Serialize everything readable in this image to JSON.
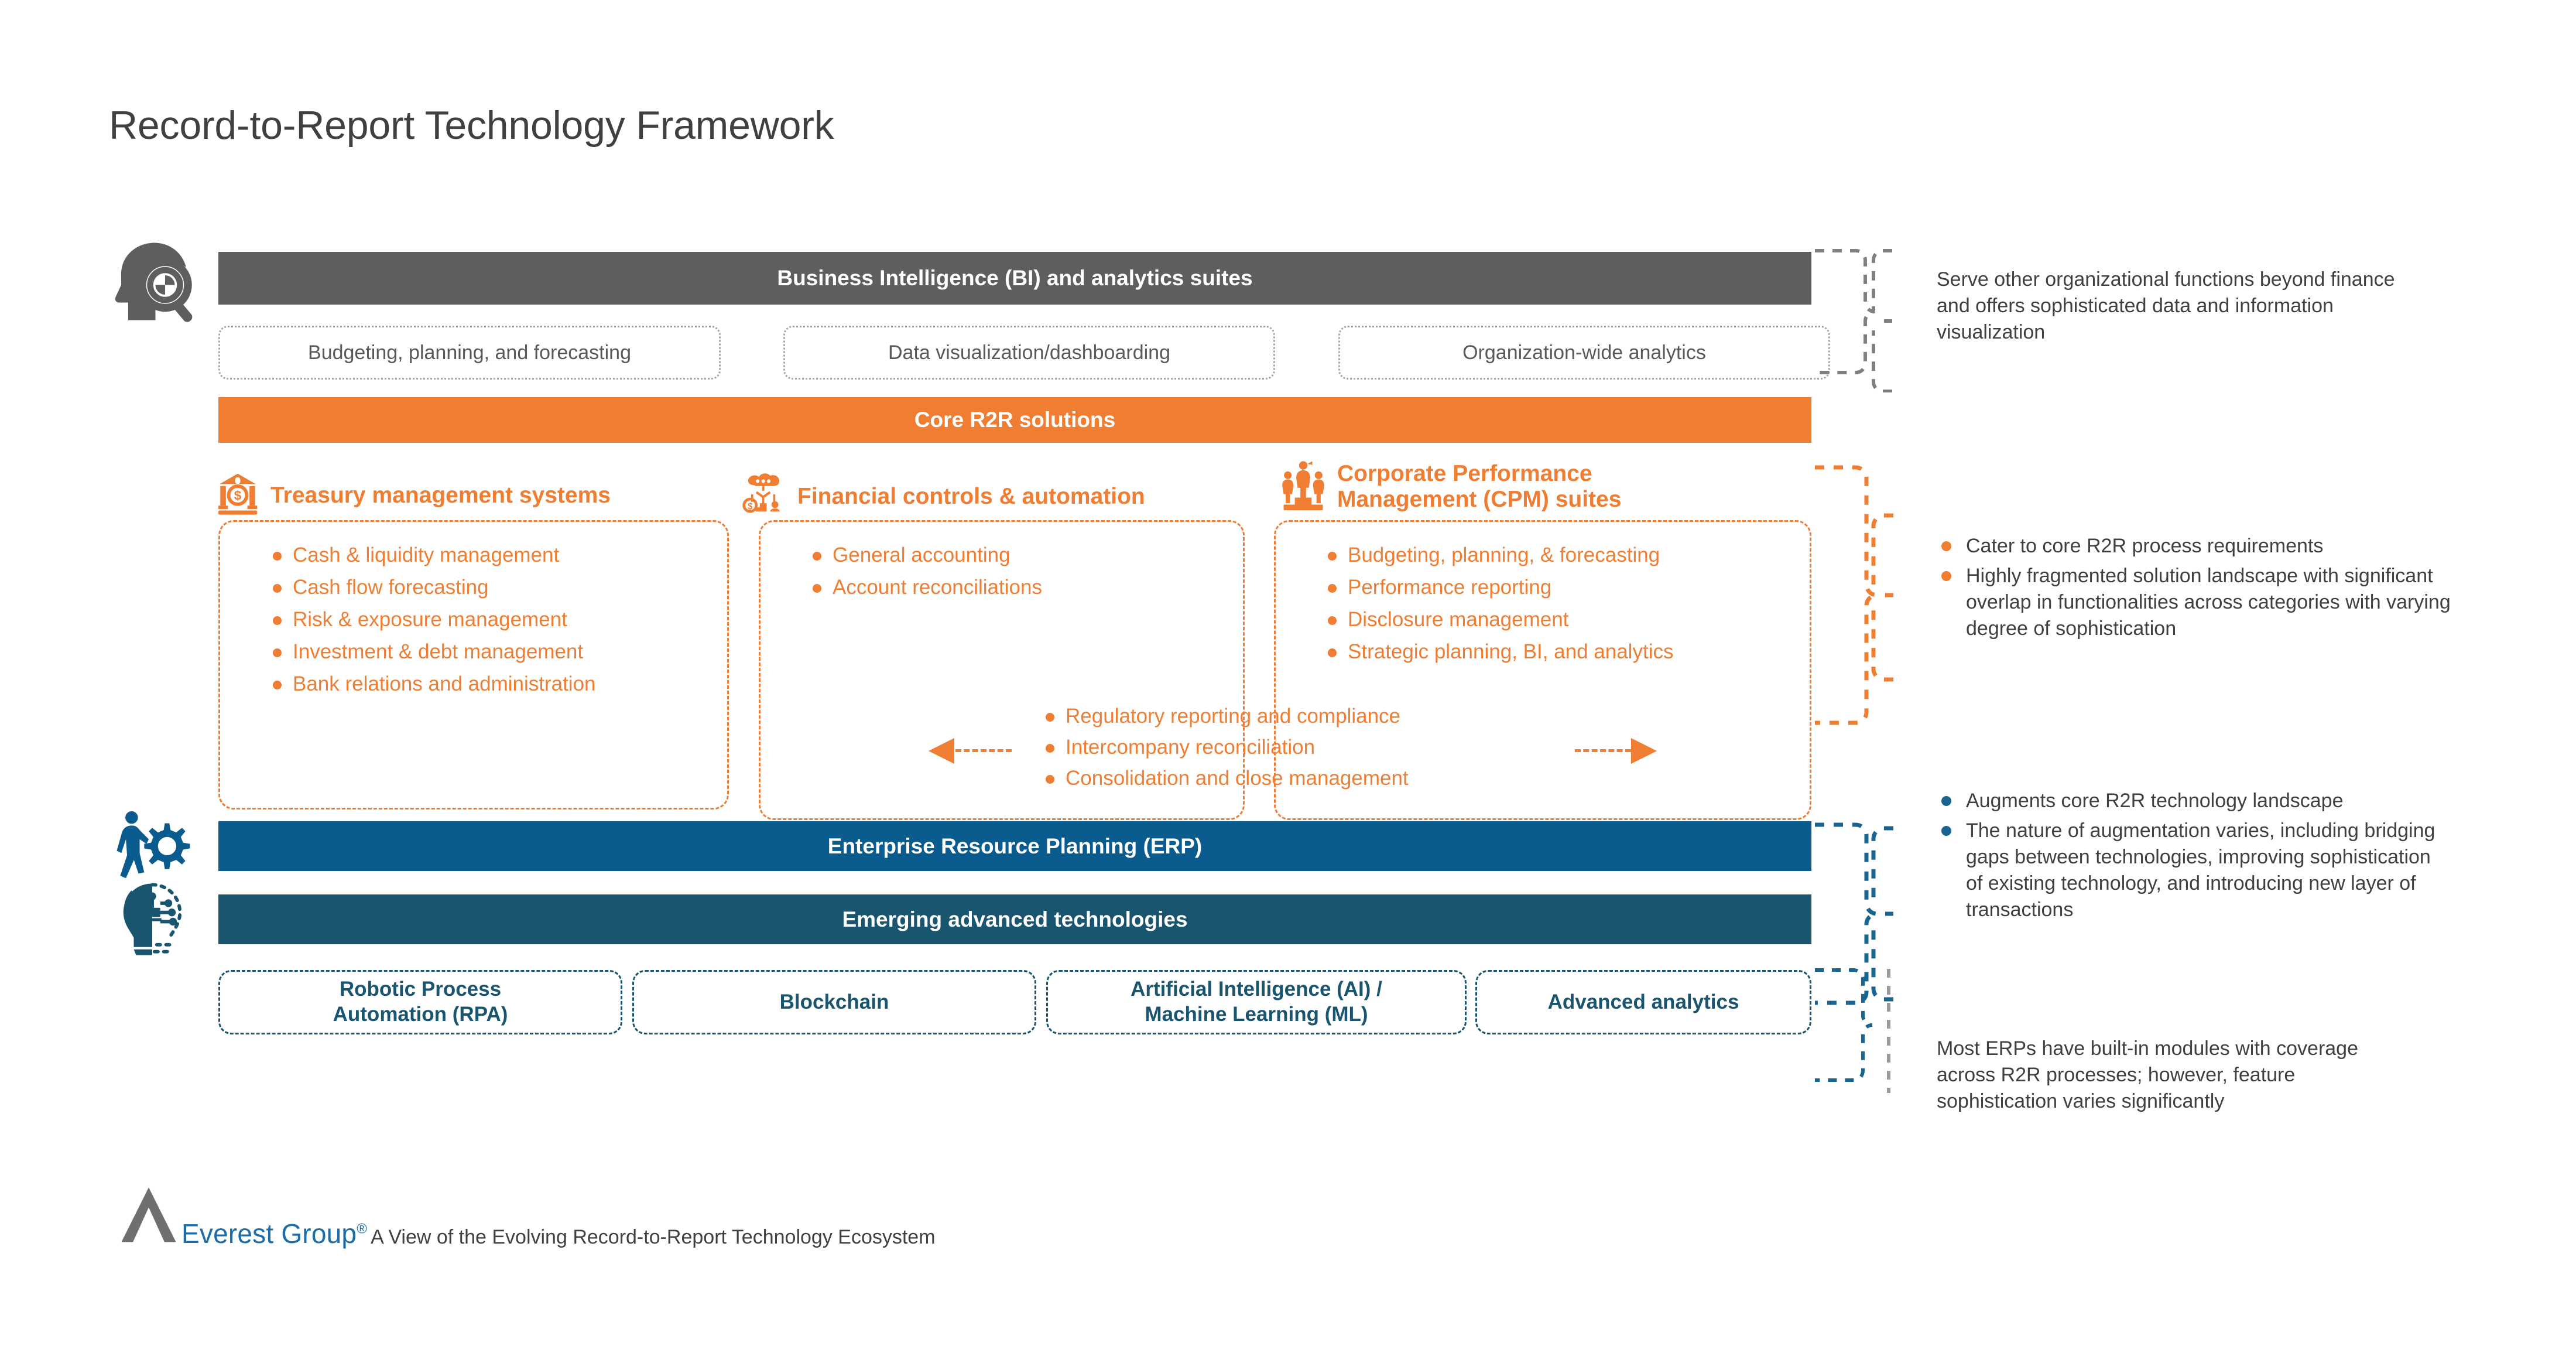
{
  "page": {
    "title": "Record-to-Report Technology Framework"
  },
  "layers": {
    "bi": {
      "bar_label": "Business Intelligence (BI) and analytics suites",
      "icon": "head-with-analytics-magnifier-icon",
      "color": "#5e5e5e",
      "boxes": [
        "Budgeting, planning, and forecasting",
        "Data visualization/dashboarding",
        "Organization-wide analytics"
      ]
    },
    "core": {
      "bar_label": "Core R2R solutions",
      "color": "#ef7d32",
      "categories": [
        {
          "title": "Treasury management systems",
          "icon": "bank-building-dollar-icon",
          "items": [
            "Cash & liquidity management",
            "Cash flow forecasting",
            "Risk & exposure management",
            "Investment & debt management",
            "Bank relations and administration"
          ]
        },
        {
          "title": "Financial controls & automation",
          "icon": "cloud-robot-automation-icon",
          "items": [
            "General accounting",
            "Account reconciliations"
          ]
        },
        {
          "title": "Corporate Performance Management (CPM) suites",
          "title_line1": "Corporate Performance",
          "title_line2": "Management (CPM) suites",
          "icon": "people-on-podium-icon",
          "items": [
            "Budgeting, planning, & forecasting",
            "Performance reporting",
            "Disclosure management",
            "Strategic planning, BI, and analytics"
          ]
        }
      ],
      "shared": {
        "items": [
          "Regulatory reporting and compliance",
          "Intercompany reconciliation",
          "Consolidation and close management"
        ],
        "left_arrow": "left-double-arrow-icon",
        "right_arrow": "right-double-arrow-icon"
      }
    },
    "erp": {
      "bar_label": "Enterprise Resource Planning (ERP)",
      "icon": "person-pushing-gear-icon",
      "color": "#0b5c8e"
    },
    "emerging": {
      "bar_label": "Emerging advanced technologies",
      "icon": "lightbulb-circuit-icon",
      "color": "#1a5570",
      "boxes": [
        {
          "line1": "Robotic Process",
          "line2": "Automation (RPA)"
        },
        {
          "line1": "Blockchain",
          "line2": ""
        },
        {
          "line1": "Artificial Intelligence (AI) /",
          "line2": "Machine Learning (ML)"
        },
        {
          "line1": "Advanced analytics",
          "line2": ""
        }
      ]
    }
  },
  "annotations": {
    "bi_note": "Serve other organizational functions beyond finance and offers sophisticated data and information visualization",
    "core_notes": [
      "Cater to core R2R process requirements",
      "Highly fragmented solution landscape with significant overlap in functionalities across categories with varying degree of sophistication"
    ],
    "tech_notes": [
      "Augments core R2R technology landscape",
      "The nature of augmentation varies, including bridging gaps between technologies, improving sophistication of existing technology, and introducing new layer of transactions"
    ],
    "erp_note": "Most ERPs have built-in modules with coverage across R2R processes; however, feature sophistication varies significantly"
  },
  "footer": {
    "brand": "Everest Group",
    "registered_mark": "®",
    "tagline": "A View of the Evolving Record-to-Report Technology Ecosystem",
    "logo": "everest-peak-logo-icon"
  },
  "colors": {
    "orange": "#ef7d32",
    "gray_bar": "#5e5e5e",
    "erp_blue": "#0b5c8e",
    "emerging_blue": "#1a5570",
    "text": "#404040",
    "brand_blue": "#1b6ca8"
  }
}
